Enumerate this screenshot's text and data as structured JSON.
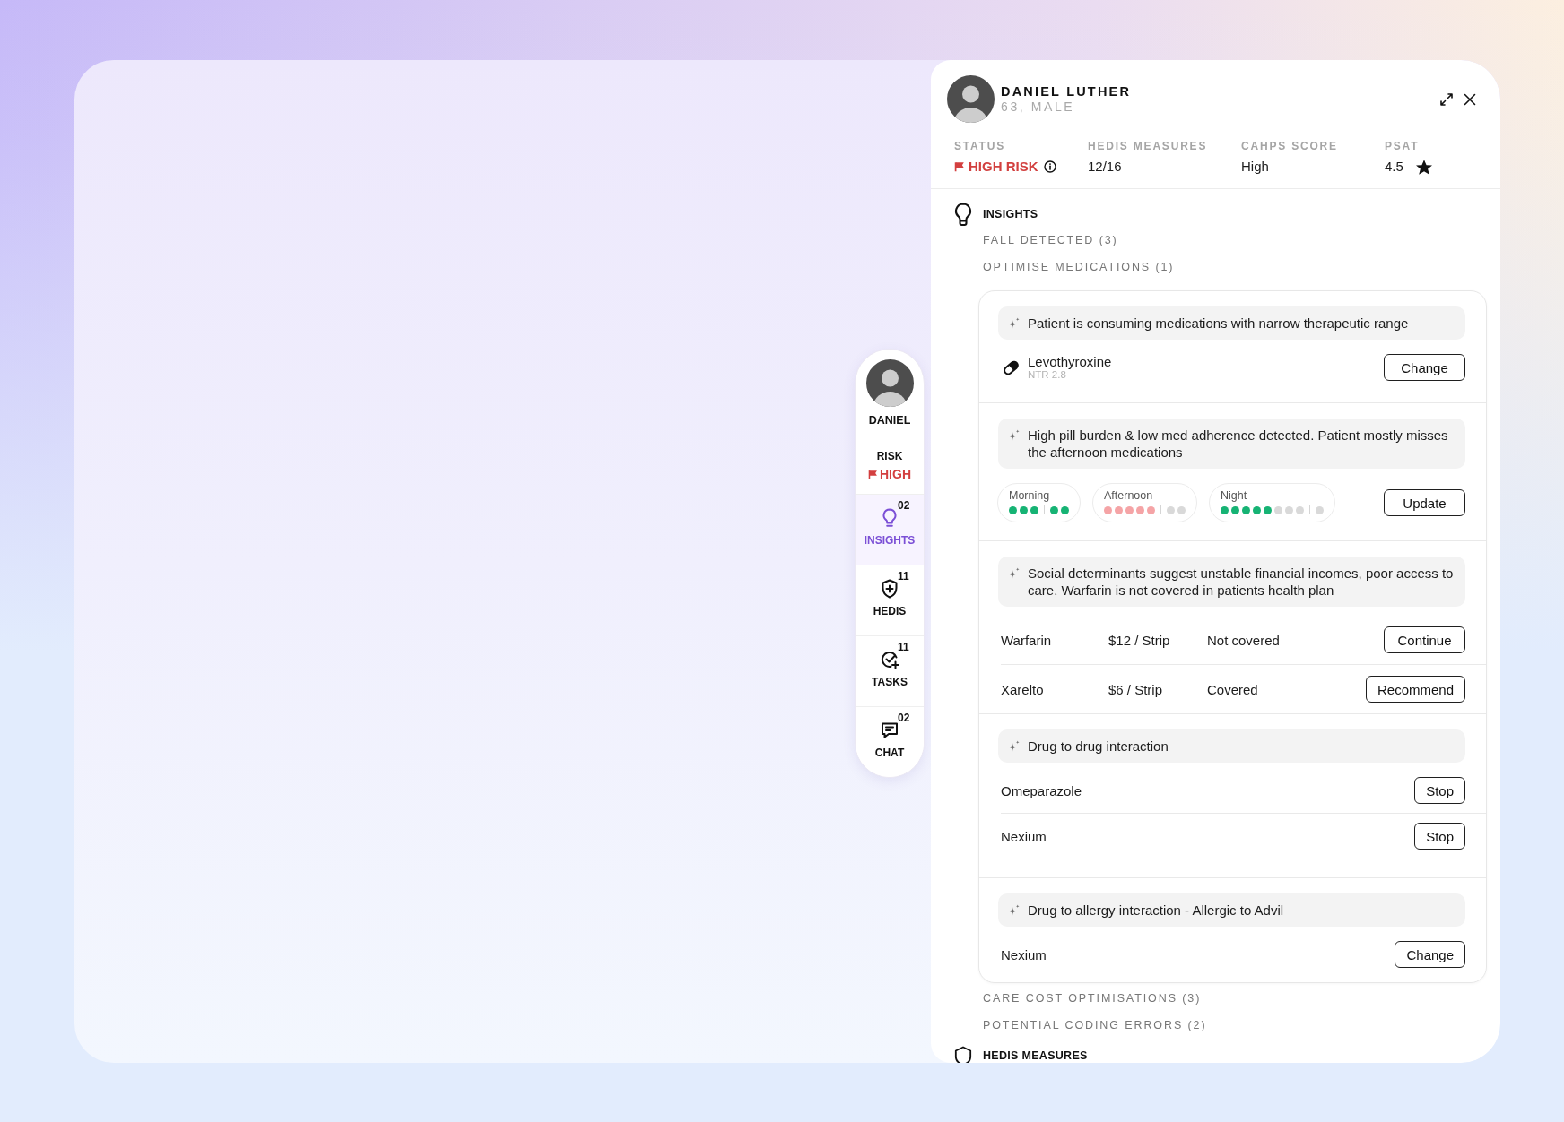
{
  "sidebar": {
    "patient": "DANIEL",
    "risk_label": "RISK",
    "risk_value": "HIGH",
    "nav": [
      {
        "label": "INSIGHTS",
        "count": "02",
        "selected": true
      },
      {
        "label": "HEDIS",
        "count": "11",
        "selected": false
      },
      {
        "label": "TASKS",
        "count": "11",
        "selected": false
      },
      {
        "label": "CHAT",
        "count": "02",
        "selected": false
      }
    ]
  },
  "patient": {
    "name": "DANIEL LUTHER",
    "details": "63, MALE"
  },
  "stats": [
    {
      "kind": "status",
      "label": "STATUS",
      "value": "HIGH RISK"
    },
    {
      "kind": "text",
      "label": "HEDIS MEASURES",
      "value": "12/16"
    },
    {
      "kind": "text",
      "label": "CAHPS SCORE",
      "value": "High"
    },
    {
      "kind": "rating",
      "label": "PSAT",
      "value": "4.5"
    }
  ],
  "sections": [
    {
      "title": "INSIGHTS",
      "categories": [
        {
          "label": "FALL DETECTED (3)"
        },
        {
          "label": "OPTIMISE MEDICATIONS (1)",
          "findings": [
            {
              "kind": "medication",
              "insight": "Patient is consuming medications with narrow therapeutic range",
              "medication": "Levothyroxine",
              "detail": "NTR 2.8",
              "action": "Change"
            },
            {
              "kind": "adherence",
              "insight": "High pill burden & low med adherence detected. Patient mostly misses the afternoon medications",
              "schedule": [
                {
                  "label": "Morning",
                  "groups": [
                    {
                      "dots": [
                        {
                          "color": "#16b374"
                        },
                        {
                          "color": "#16b374"
                        },
                        {
                          "color": "#16b374"
                        }
                      ]
                    },
                    {
                      "dots": [
                        {
                          "color": "#16b374"
                        },
                        {
                          "color": "#16b374"
                        }
                      ]
                    }
                  ]
                },
                {
                  "label": "Afternoon",
                  "groups": [
                    {
                      "dots": [
                        {
                          "color": "#f5a4a6"
                        },
                        {
                          "color": "#f5a4a6"
                        },
                        {
                          "color": "#f5a4a6"
                        },
                        {
                          "color": "#f5a4a6"
                        },
                        {
                          "color": "#f5a4a6"
                        }
                      ]
                    },
                    {
                      "dots": [
                        {
                          "color": "#d9d9d9"
                        },
                        {
                          "color": "#d9d9d9"
                        }
                      ]
                    }
                  ]
                },
                {
                  "label": "Night",
                  "groups": [
                    {
                      "dots": [
                        {
                          "color": "#16b374"
                        },
                        {
                          "color": "#16b374"
                        },
                        {
                          "color": "#16b374"
                        },
                        {
                          "color": "#16b374"
                        },
                        {
                          "color": "#16b374"
                        },
                        {
                          "color": "#d9d9d9"
                        },
                        {
                          "color": "#d9d9d9"
                        },
                        {
                          "color": "#d9d9d9"
                        }
                      ]
                    },
                    {
                      "dots": [
                        {
                          "color": "#d9d9d9"
                        }
                      ]
                    }
                  ]
                }
              ],
              "action": "Update"
            },
            {
              "kind": "cost",
              "insight": "Social determinants suggest unstable financial incomes, poor access to care. Warfarin is not covered in patients health plan",
              "rows": [
                {
                  "cells": [
                    "Warfarin",
                    "$12 / Strip",
                    "Not covered"
                  ],
                  "action": "Continue"
                },
                {
                  "cells": [
                    "Xarelto",
                    "$6 / Strip",
                    "Covered"
                  ],
                  "action": "Recommend"
                }
              ]
            },
            {
              "kind": "interaction",
              "insight": "Drug to drug interaction",
              "rows": [
                {
                  "cells": [
                    "Omeparazole"
                  ],
                  "action": "Stop"
                },
                {
                  "cells": [
                    "Nexium"
                  ],
                  "action": "Stop"
                }
              ]
            },
            {
              "kind": "interaction",
              "insight": "Drug to allergy interaction - Allergic to Advil",
              "rows": [
                {
                  "cells": [
                    "Nexium"
                  ],
                  "action": "Change"
                }
              ]
            }
          ]
        },
        {
          "label": "CARE COST OPTIMISATIONS (3)"
        },
        {
          "label": "POTENTIAL CODING ERRORS (2)"
        }
      ]
    },
    {
      "title": "HEDIS MEASURES"
    }
  ]
}
